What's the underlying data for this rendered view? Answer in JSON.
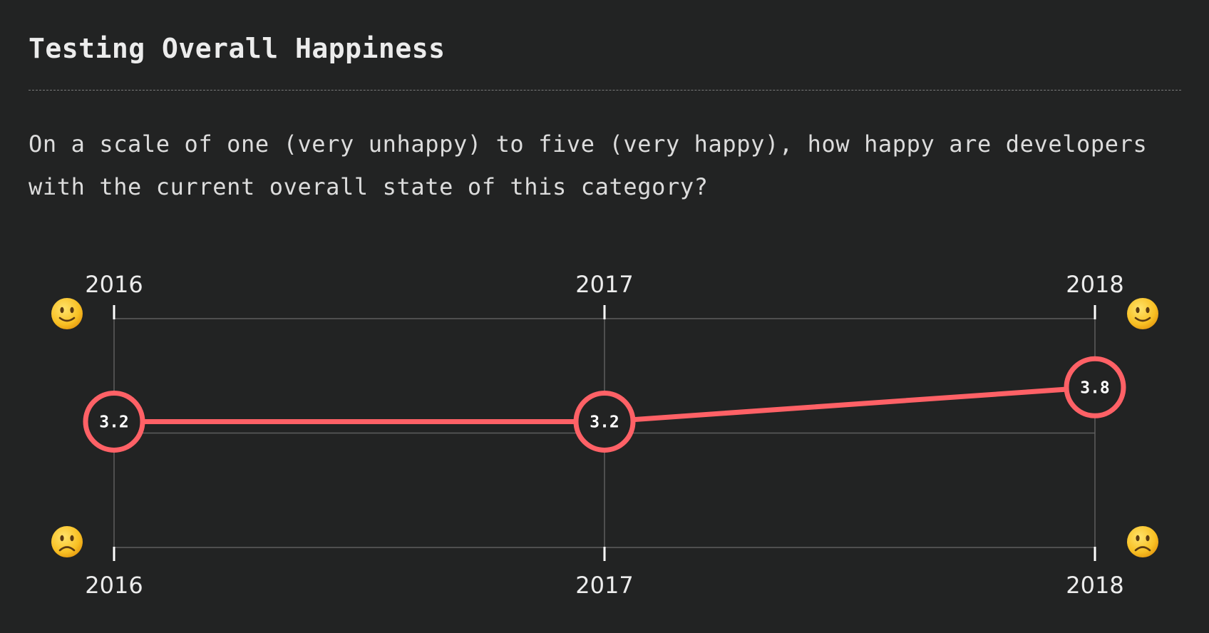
{
  "title": "Testing Overall Happiness",
  "description": "On a scale of one (very unhappy) to five (very happy), how happy are developers with the current overall state of this category?",
  "icons": {
    "happy": "slightly-smiling-face-icon",
    "unhappy": "frowning-face-icon"
  },
  "colors": {
    "background": "#222323",
    "series": "#ff6166",
    "grid": "#5e5e5e",
    "text": "#ececec"
  },
  "chart_data": {
    "type": "line",
    "x": [
      "2016",
      "2017",
      "2018"
    ],
    "series": [
      {
        "values": [
          3.2,
          3.2,
          3.8
        ]
      }
    ],
    "value_labels": [
      "3.2",
      "3.2",
      "3.8"
    ],
    "ylim": [
      1,
      5
    ],
    "grid": true,
    "title": "",
    "xlabel": "",
    "ylabel": ""
  }
}
